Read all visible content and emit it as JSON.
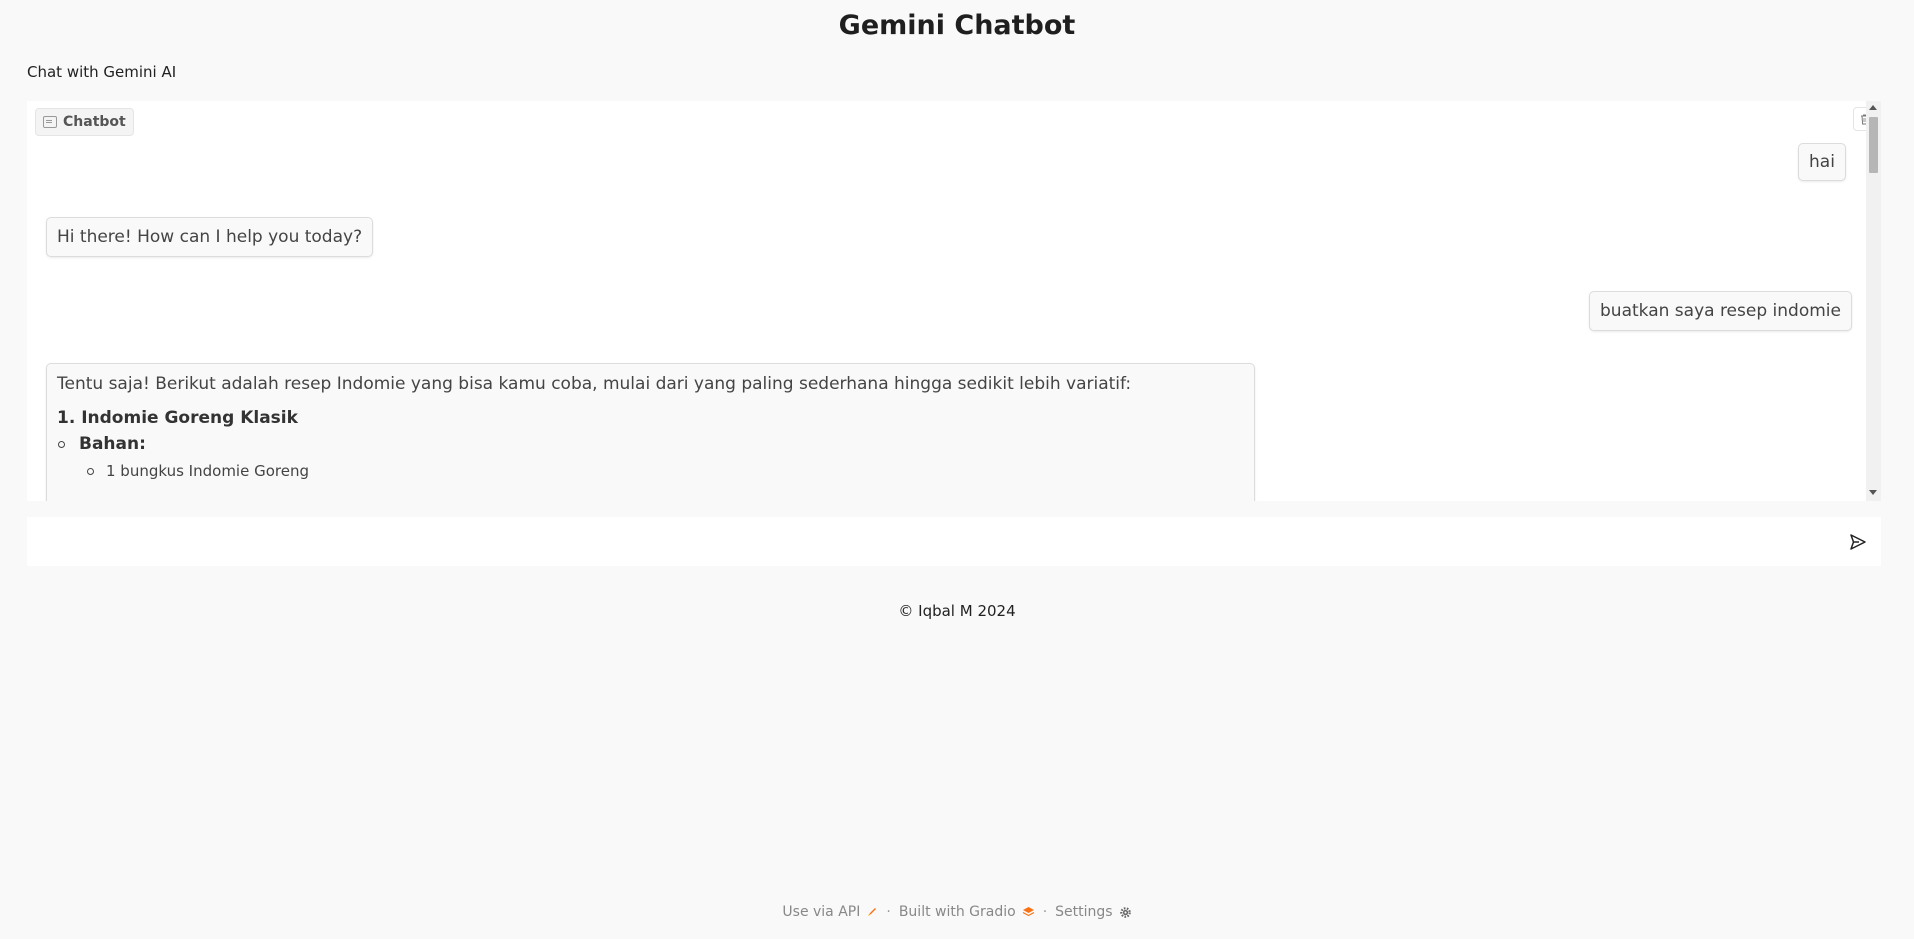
{
  "header": {
    "title": "Gemini Chatbot",
    "subtitle": "Chat with Gemini AI"
  },
  "chatbot": {
    "label": "Chatbot",
    "messages": [
      {
        "role": "user",
        "text": "hai"
      },
      {
        "role": "bot",
        "text": "Hi there! How can I help you today?"
      },
      {
        "role": "user",
        "text": "buatkan saya resep indomie"
      },
      {
        "role": "bot",
        "intro": "Tentu saja! Berikut adalah resep Indomie yang bisa kamu coba, mulai dari yang paling sederhana hingga sedikit lebih variatif:",
        "heading": "1. Indomie Goreng Klasik",
        "list_item": "Bahan:",
        "sub_item": "1 bungkus Indomie Goreng"
      }
    ]
  },
  "input": {
    "value": "",
    "placeholder": ""
  },
  "copyright": "© Iqbal M 2024",
  "footer": {
    "api_label": "Use via API",
    "built_label": "Built with Gradio",
    "settings_label": "Settings",
    "separator": "·"
  },
  "colors": {
    "background": "#f9f9f9",
    "panel": "#ffffff",
    "bubble": "#f9f9f9",
    "accent": "#f97316"
  },
  "icons": [
    "chat-icon",
    "trash-icon",
    "send-icon",
    "rocket-icon",
    "gradio-logo-icon",
    "gear-icon"
  ]
}
